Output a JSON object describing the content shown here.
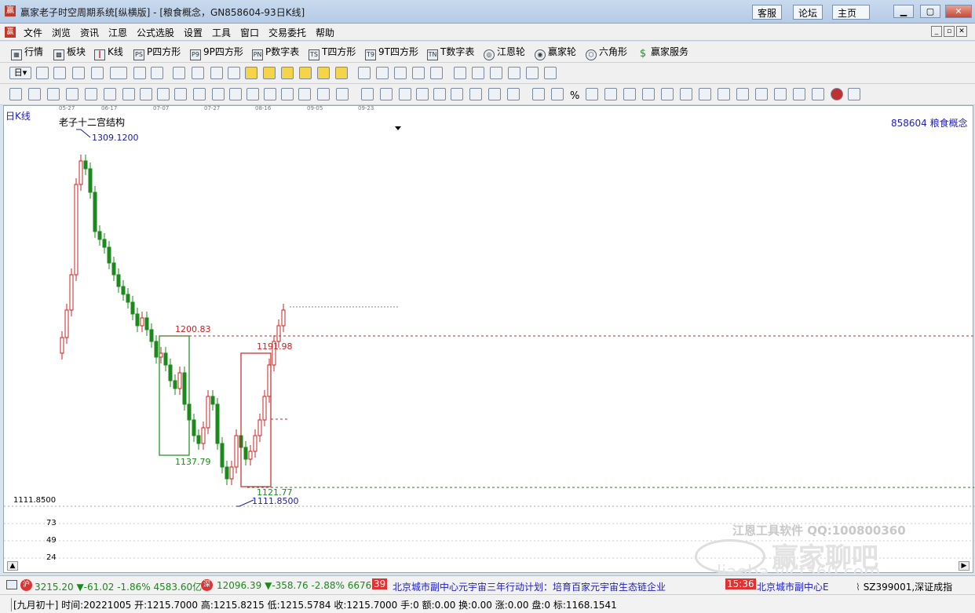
{
  "window": {
    "title": "赢家老子时空周期系统[纵横版] - [粮食概念，GN858604-93日K线]",
    "buttons": [
      "客服",
      "论坛",
      "主页"
    ]
  },
  "menu": [
    "文件",
    "浏览",
    "资讯",
    "江恩",
    "公式选股",
    "设置",
    "工具",
    "窗口",
    "交易委托",
    "帮助"
  ],
  "toolbar1": [
    "行情",
    "板块",
    "K线",
    "P四方形",
    "9P四方形",
    "P数字表",
    "T四方形",
    "9T四方形",
    "T数字表",
    "江恩轮",
    "赢家轮",
    "六角形",
    "赢家服务"
  ],
  "chart": {
    "period_label": "日K线",
    "indicator": "老子十二宫结构",
    "code_name": "858604 粮食概念",
    "date_ticks": [
      "05-27",
      "06-17",
      "07-07",
      "07-27",
      "08-16",
      "09-05",
      "09-23"
    ],
    "y_axis_labels": [
      "1111.8500",
      "73",
      "49",
      "24"
    ],
    "annotations": {
      "high": "1309.1200",
      "box1_top": "1200.83",
      "box1_low": "1137.79",
      "box2_top": "1191.98",
      "box2_low": "1121.77",
      "low": "1111.8500"
    },
    "watermark": "江恩工具软件 QQ:100800360",
    "watermark2": "赢家聊吧",
    "watermark3": "liaoba.yjcf360.com"
  },
  "chart_data": {
    "type": "candlestick",
    "high": 1309.12,
    "low": 1111.85,
    "levels": [
      1200.83,
      1191.98,
      1137.79,
      1121.77
    ]
  },
  "status": {
    "sh_value": "3215.20",
    "sh_change": "▼-61.02",
    "sh_pct": "-1.86%",
    "sh_amount": "4583.60亿",
    "sz_value": "12096.39",
    "sz_change": "▼-358.76",
    "sz_pct": "-2.88%",
    "sz_amount": "6676.7",
    "news_time1": "39",
    "news1": "北京城市副中心元宇宙三年行动计划：培育百家元宇宙生态链企业",
    "news_time2": "15:36",
    "news2": "北京城市副中心E",
    "index_code": "SZ399001,深证成指"
  },
  "info": {
    "text": "[九月初十] 时间:20221005 开:1215.7000 高:1215.8215 低:1215.5784 收:1215.7000 手:0 额:0.00 换:0.00 涨:0.00 盘:0 标:1168.1541"
  }
}
